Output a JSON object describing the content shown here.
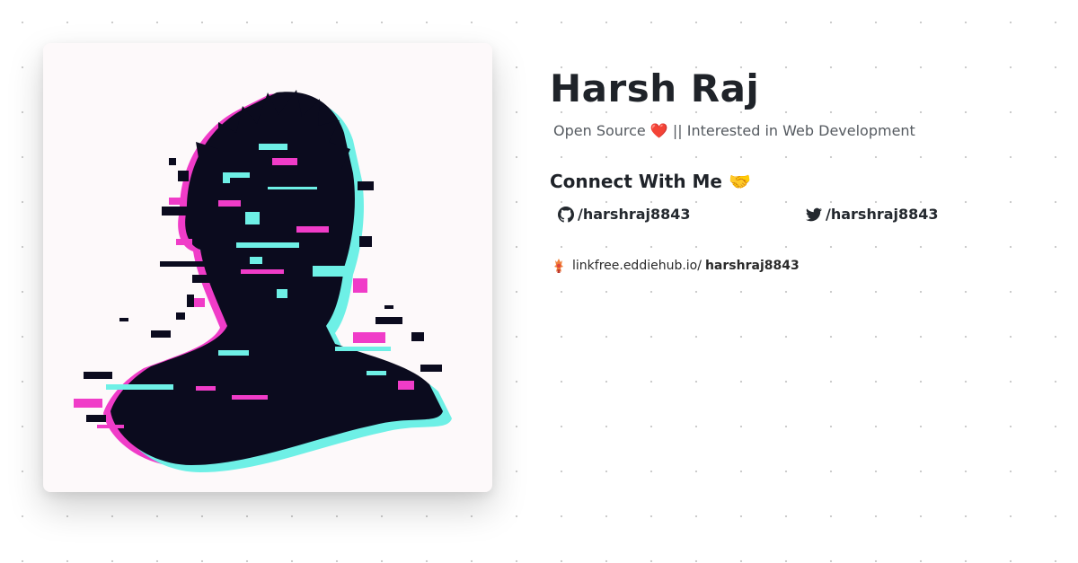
{
  "profile": {
    "name": "Harsh Raj",
    "bio": "Open Source ❤️ || Interested in Web Development",
    "avatar_icon": "glitch-portrait-avatar"
  },
  "connect": {
    "heading": "Connect With Me 🤝",
    "github": {
      "icon": "github-icon",
      "label": "/harshraj8843"
    },
    "twitter": {
      "icon": "twitter-icon",
      "label": "/harshraj8843"
    }
  },
  "linkfree": {
    "icon": "linkfree-logo-icon",
    "prefix": "linkfree.eddiehub.io/",
    "username": "harshraj8843"
  },
  "colors": {
    "glitch_pink": "#f03cc8",
    "glitch_cyan": "#6ef0e6",
    "silhouette": "#0b0b1e"
  }
}
